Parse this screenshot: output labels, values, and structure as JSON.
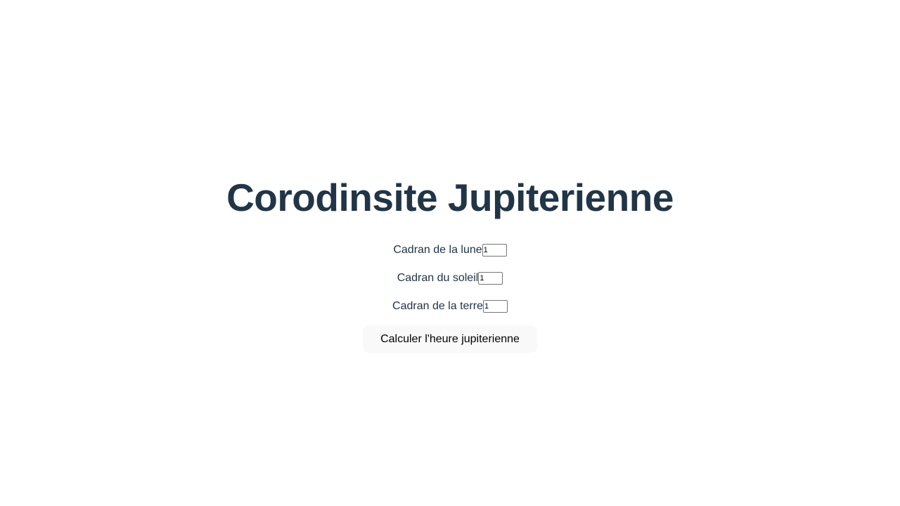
{
  "title": "Corodinsite Jupiterienne",
  "fields": [
    {
      "label": "Cadran de la lune",
      "value": "1"
    },
    {
      "label": "Cadran du soleil",
      "value": "1"
    },
    {
      "label": "Cadran de la terre",
      "value": "1"
    }
  ],
  "submit_label": "Calculer l'heure jupiterienne"
}
